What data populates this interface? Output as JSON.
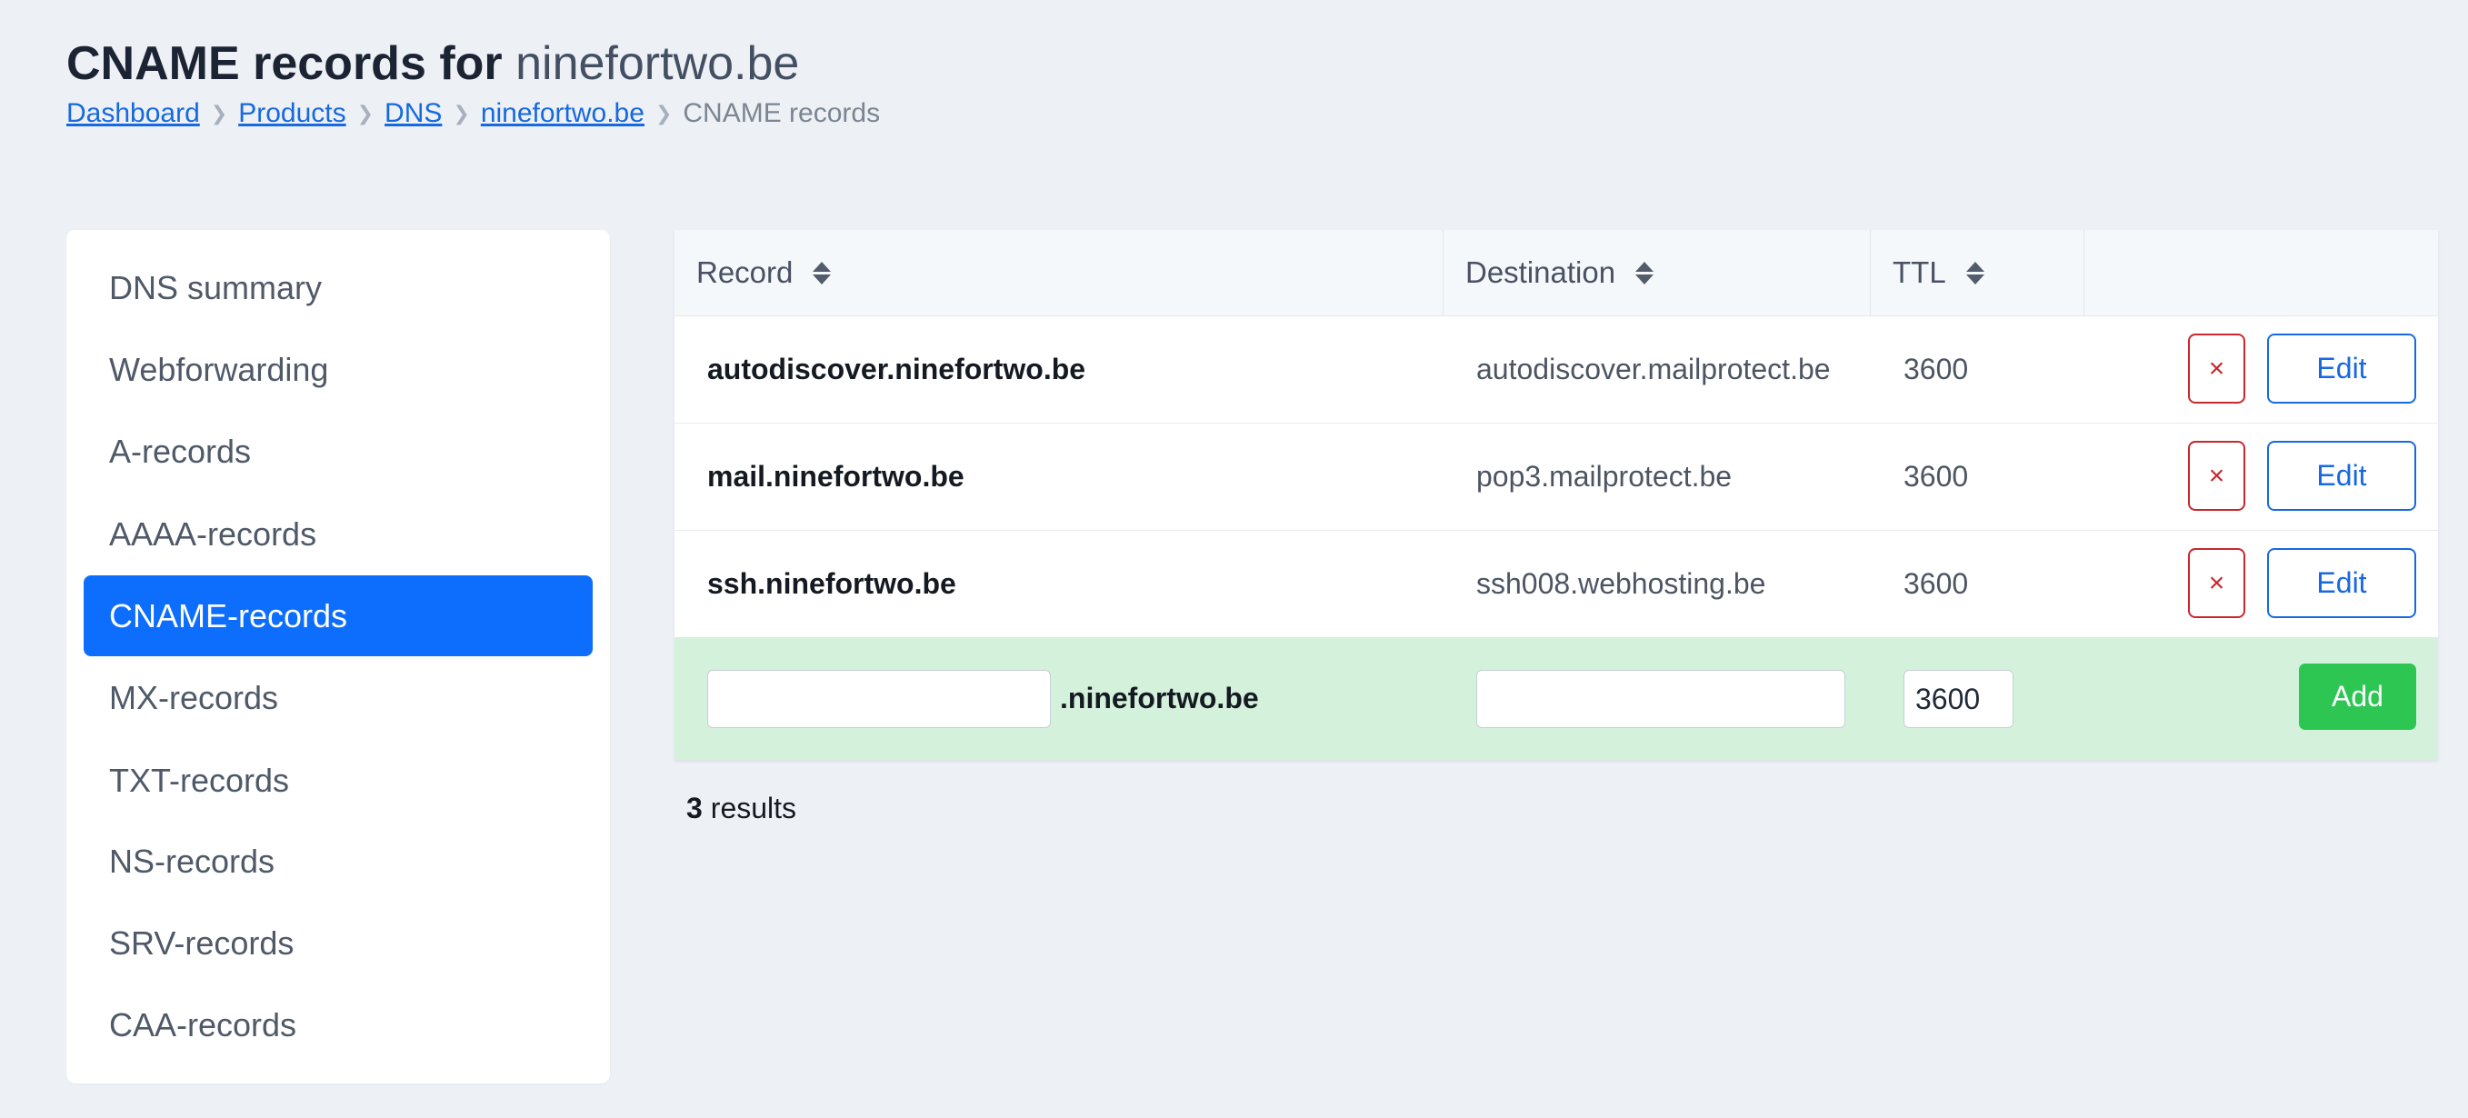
{
  "header": {
    "title_prefix": "CNAME records for",
    "title_domain": "ninefortwo.be"
  },
  "breadcrumb": {
    "items": [
      "Dashboard",
      "Products",
      "DNS",
      "ninefortwo.be"
    ],
    "separator": "❯",
    "current": "CNAME records"
  },
  "sidebar": {
    "items": [
      {
        "label": "DNS summary"
      },
      {
        "label": "Webforwarding"
      },
      {
        "label": "A-records"
      },
      {
        "label": "AAAA-records"
      },
      {
        "label": "CNAME-records",
        "active": true
      },
      {
        "label": "MX-records"
      },
      {
        "label": "TXT-records"
      },
      {
        "label": "NS-records"
      },
      {
        "label": "SRV-records"
      },
      {
        "label": "CAA-records"
      }
    ]
  },
  "table": {
    "columns": [
      {
        "label": "Record",
        "sortable": true
      },
      {
        "label": "Destination",
        "sortable": true
      },
      {
        "label": "TTL",
        "sortable": true
      },
      {
        "label": "",
        "sortable": false
      }
    ],
    "rows": [
      {
        "record": "autodiscover.ninefortwo.be",
        "destination": "autodiscover.mailprotect.be",
        "ttl": "3600"
      },
      {
        "record": "mail.ninefortwo.be",
        "destination": "pop3.mailprotect.be",
        "ttl": "3600"
      },
      {
        "record": "ssh.ninefortwo.be",
        "destination": "ssh008.webhosting.be",
        "ttl": "3600"
      }
    ],
    "row_actions": {
      "delete_label": "×",
      "edit_label": "Edit"
    },
    "add_row": {
      "record_value": "",
      "record_suffix": ".ninefortwo.be",
      "destination_value": "",
      "ttl_value": "3600",
      "add_label": "Add"
    }
  },
  "results": {
    "count": "3",
    "label": "results"
  },
  "colors": {
    "accent": "#0d6efd",
    "link": "#1769e0",
    "danger": "#c7282e",
    "success": "#2dc653",
    "add_row_bg": "#d4f1dc",
    "page_bg": "#edf1f6"
  }
}
